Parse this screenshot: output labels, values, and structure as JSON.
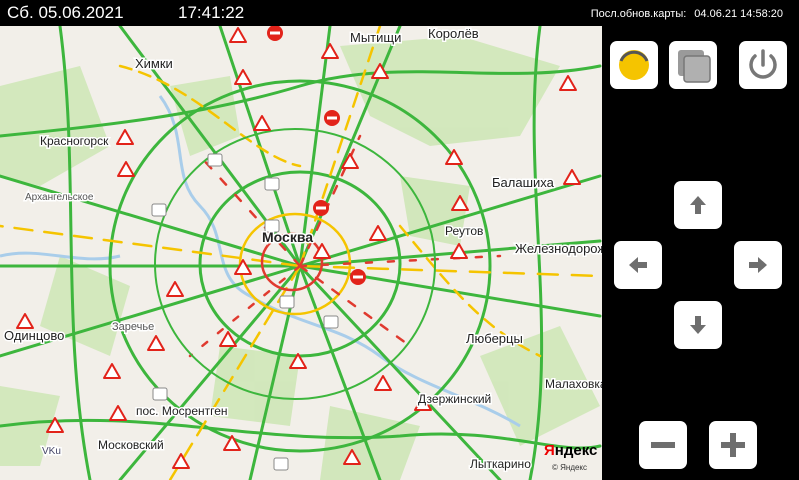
{
  "topbar": {
    "date": "Сб. 05.06.2021",
    "time": "17:41:22",
    "updated_label": "Посл.обнов.карты:",
    "updated_value": "04.06.21 14:58:20"
  },
  "map": {
    "labels": {
      "mytishchi": "Мытищи",
      "korolev": "Королёв",
      "khimki": "Химки",
      "krasnogorsk": "Красногорск",
      "moskva": "Москва",
      "balashikha": "Балашиха",
      "reutov": "Реутов",
      "zheleznodorozhny": "Железнодорожный",
      "zarechye": "Заречье",
      "odintsovo": "Одинцово",
      "lyubertsy": "Люберцы",
      "dzerzhinsky": "Дзержинский",
      "malakhovka": "Малаховка",
      "moskovsky": "Московский",
      "mos_rentgen": "пос. Мосрентген",
      "lytkarino": "Лыткарино",
      "arkhangelskoe": "Архангельское",
      "vku": "VKu"
    },
    "logo_first": "Я",
    "logo_rest": "ндекс",
    "logo_small": "© Яндекс",
    "colors": {
      "background": "#f2efe9",
      "park": "#cfe7b8",
      "traffic_free": "#3db63d",
      "traffic_slow": "#f5c400",
      "traffic_jam": "#e03a2f",
      "sign_red": "#e2231a"
    }
  },
  "controls": {
    "traffic_toggle_icon": "traffic-light-icon",
    "layers_icon": "layers-icon",
    "power_icon": "power-icon",
    "up_icon": "arrow-up-icon",
    "left_icon": "arrow-left-icon",
    "right_icon": "arrow-right-icon",
    "down_icon": "arrow-down-icon",
    "zoom_out_icon": "minus-icon",
    "zoom_in_icon": "plus-icon"
  }
}
